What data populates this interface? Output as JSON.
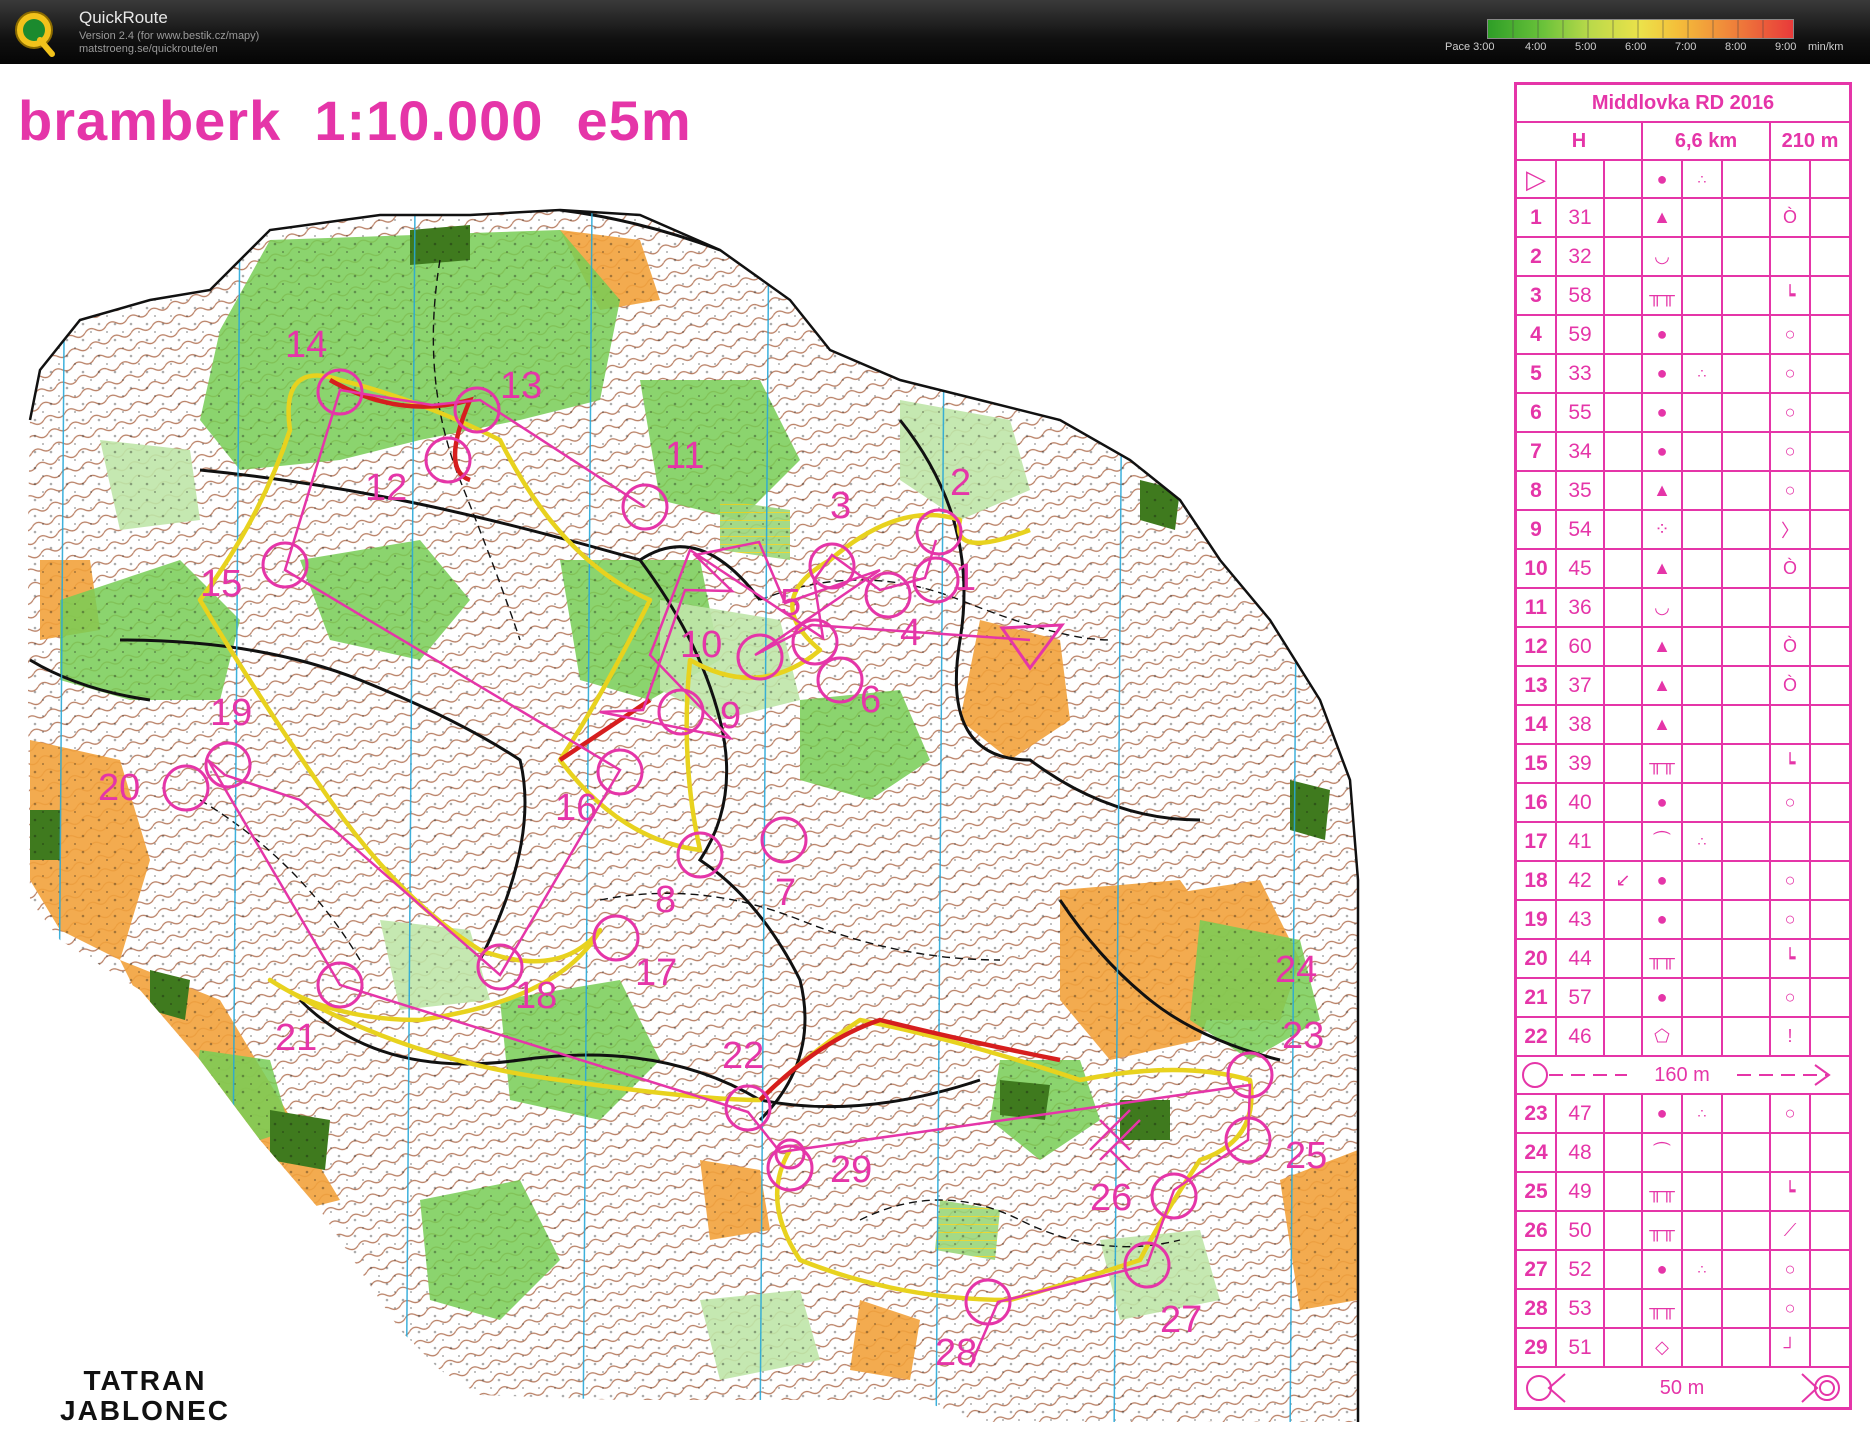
{
  "app": {
    "name": "QuickRoute",
    "version_line": "Version 2.4  (for www.bestik.cz/mapy)",
    "url_line": "matstroeng.se/quickroute/en",
    "logo_letter": "Q"
  },
  "pace_legend": {
    "prefix": "Pace 3:00",
    "ticks": [
      "4:00",
      "5:00",
      "6:00",
      "7:00",
      "8:00",
      "9:00"
    ],
    "unit": "min/km",
    "colors": [
      "#2e9e27",
      "#b8d94a",
      "#ece24a",
      "#f08a3a",
      "#e83a3a"
    ]
  },
  "map": {
    "title": "bramberk  1:10.000  e5m",
    "club_line1": "TATRAN",
    "club_line2": "JABLONEC",
    "colors": {
      "overprint": "#e535a8",
      "forest_green": "#77cc55",
      "light_green": "#bfe6a8",
      "open_yellow": "#f2a23c",
      "contour_brown": "#a0522d",
      "route_yellow": "#e8d21e",
      "route_red": "#d61e1e",
      "magnetic_blue": "#29a8d8",
      "dark_green": "#3f7a1e"
    },
    "control_numbers": [
      "1",
      "2",
      "3",
      "4",
      "5",
      "6",
      "7",
      "8",
      "9",
      "10",
      "11",
      "12",
      "13",
      "14",
      "15",
      "16",
      "17",
      "18",
      "19",
      "20",
      "21",
      "22",
      "23",
      "24",
      "25",
      "26",
      "27",
      "28",
      "29"
    ]
  },
  "description_sheet": {
    "event": "Middlovka RD 2016",
    "category": "H",
    "length": "6,6 km",
    "climb": "210 m",
    "start_symbol": "▷",
    "start_feature": "●",
    "start_detail": "∴",
    "controls": [
      {
        "n": "1",
        "code": "31",
        "dir": "",
        "feature": "▲",
        "detail": "",
        "pos": "Ò"
      },
      {
        "n": "2",
        "code": "32",
        "dir": "",
        "feature": "◡",
        "detail": "",
        "pos": ""
      },
      {
        "n": "3",
        "code": "58",
        "dir": "",
        "feature": "╥╥",
        "detail": "",
        "pos": "┕"
      },
      {
        "n": "4",
        "code": "59",
        "dir": "",
        "feature": "●",
        "detail": "",
        "pos": "○"
      },
      {
        "n": "5",
        "code": "33",
        "dir": "",
        "feature": "●",
        "detail": "∴",
        "pos": "○"
      },
      {
        "n": "6",
        "code": "55",
        "dir": "",
        "feature": "●",
        "detail": "",
        "pos": "○"
      },
      {
        "n": "7",
        "code": "34",
        "dir": "",
        "feature": "●",
        "detail": "",
        "pos": "○"
      },
      {
        "n": "8",
        "code": "35",
        "dir": "",
        "feature": "▲",
        "detail": "",
        "pos": "○"
      },
      {
        "n": "9",
        "code": "54",
        "dir": "",
        "feature": "⁘",
        "detail": "",
        "pos": "〉"
      },
      {
        "n": "10",
        "code": "45",
        "dir": "",
        "feature": "▲",
        "detail": "",
        "pos": "Ò"
      },
      {
        "n": "11",
        "code": "36",
        "dir": "",
        "feature": "◡",
        "detail": "",
        "pos": ""
      },
      {
        "n": "12",
        "code": "60",
        "dir": "",
        "feature": "▲",
        "detail": "",
        "pos": "Ò"
      },
      {
        "n": "13",
        "code": "37",
        "dir": "",
        "feature": "▲",
        "detail": "",
        "pos": "Ò"
      },
      {
        "n": "14",
        "code": "38",
        "dir": "",
        "feature": "▲",
        "detail": "",
        "pos": ""
      },
      {
        "n": "15",
        "code": "39",
        "dir": "",
        "feature": "╥╥",
        "detail": "",
        "pos": "┕"
      },
      {
        "n": "16",
        "code": "40",
        "dir": "",
        "feature": "●",
        "detail": "",
        "pos": "○"
      },
      {
        "n": "17",
        "code": "41",
        "dir": "",
        "feature": "⏜",
        "detail": "∴",
        "pos": ""
      },
      {
        "n": "18",
        "code": "42",
        "dir": "↙",
        "feature": "●",
        "detail": "",
        "pos": "○"
      },
      {
        "n": "19",
        "code": "43",
        "dir": "",
        "feature": "●",
        "detail": "",
        "pos": "○"
      },
      {
        "n": "20",
        "code": "44",
        "dir": "",
        "feature": "╥╥",
        "detail": "",
        "pos": "┕"
      },
      {
        "n": "21",
        "code": "57",
        "dir": "",
        "feature": "●",
        "detail": "",
        "pos": "○"
      },
      {
        "n": "22",
        "code": "46",
        "dir": "",
        "feature": "⬠",
        "detail": "",
        "pos": "!"
      }
    ],
    "taped_route": "160 m",
    "controls_after": [
      {
        "n": "23",
        "code": "47",
        "dir": "",
        "feature": "●",
        "detail": "∴",
        "pos": "○"
      },
      {
        "n": "24",
        "code": "48",
        "dir": "",
        "feature": "⏜",
        "detail": "",
        "pos": ""
      },
      {
        "n": "25",
        "code": "49",
        "dir": "",
        "feature": "╥╥",
        "detail": "",
        "pos": "┕"
      },
      {
        "n": "26",
        "code": "50",
        "dir": "",
        "feature": "╥╥",
        "detail": "",
        "pos": "⟋"
      },
      {
        "n": "27",
        "code": "52",
        "dir": "",
        "feature": "●",
        "detail": "∴",
        "pos": "○"
      },
      {
        "n": "28",
        "code": "53",
        "dir": "",
        "feature": "╥╥",
        "detail": "",
        "pos": "○"
      },
      {
        "n": "29",
        "code": "51",
        "dir": "",
        "feature": "◇",
        "detail": "",
        "pos": "┘"
      }
    ],
    "finish_distance": "50 m"
  }
}
